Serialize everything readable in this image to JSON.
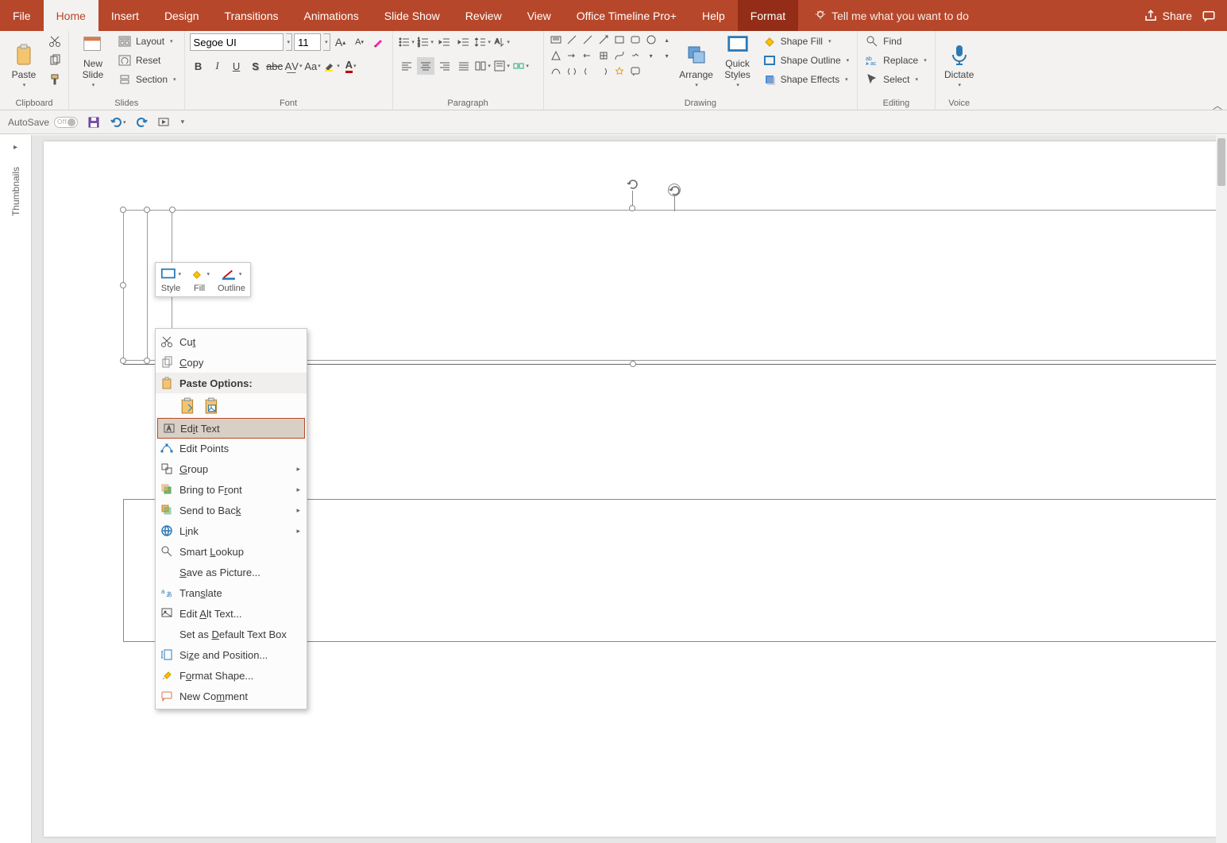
{
  "tabs": {
    "file": "File",
    "home": "Home",
    "insert": "Insert",
    "design": "Design",
    "transitions": "Transitions",
    "animations": "Animations",
    "slideshow": "Slide Show",
    "review": "Review",
    "view": "View",
    "timeline": "Office Timeline Pro+",
    "help": "Help",
    "format": "Format",
    "tellme": "Tell me what you want to do",
    "share": "Share"
  },
  "ribbon": {
    "clipboard": {
      "label": "Clipboard",
      "paste": "Paste"
    },
    "slides": {
      "label": "Slides",
      "newslide": "New\nSlide",
      "layout": "Layout",
      "reset": "Reset",
      "section": "Section"
    },
    "font": {
      "label": "Font",
      "name": "Segoe UI",
      "size": "11"
    },
    "paragraph": {
      "label": "Paragraph"
    },
    "drawing": {
      "label": "Drawing",
      "arrange": "Arrange",
      "quick": "Quick\nStyles",
      "fill": "Shape Fill",
      "outline": "Shape Outline",
      "effects": "Shape Effects"
    },
    "editing": {
      "label": "Editing",
      "find": "Find",
      "replace": "Replace",
      "select": "Select"
    },
    "voice": {
      "label": "Voice",
      "dictate": "Dictate"
    }
  },
  "qat": {
    "autosave": "AutoSave",
    "off": "Off"
  },
  "thumbnails": "Thumbnails",
  "minitoolbar": {
    "style": "Style",
    "fill": "Fill",
    "outline": "Outline"
  },
  "context": {
    "cut": "Cut",
    "copy": "Copy",
    "pasteoptions": "Paste Options:",
    "edittext": "Edit Text",
    "editpoints": "Edit Points",
    "group": "Group",
    "bringfront": "Bring to Front",
    "sendback": "Send to Back",
    "link": "Link",
    "smartlookup": "Smart Lookup",
    "savepic": "Save as Picture...",
    "translate": "Translate",
    "editalt": "Edit Alt Text...",
    "setdefault": "Set as Default Text Box",
    "sizepos": "Size and Position...",
    "formatshape": "Format Shape...",
    "newcomment": "New Comment"
  }
}
